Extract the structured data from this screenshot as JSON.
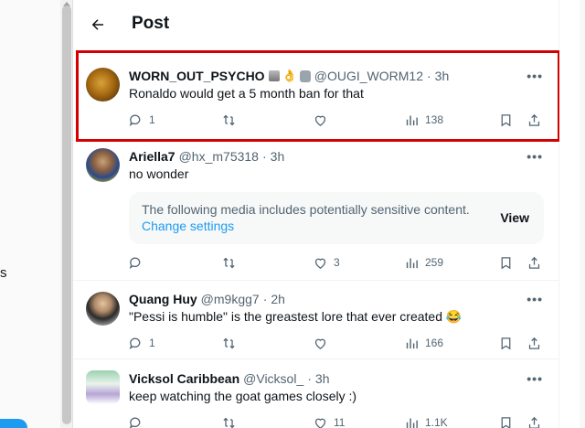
{
  "left_rail": {
    "edge_text": "s"
  },
  "header": {
    "title": "Post"
  },
  "posts": [
    {
      "name": "WORN_OUT_PSYCHO",
      "handle": "@OUGI_WORM12",
      "time": "3h",
      "text": "Ronaldo would get a 5 month ban for that",
      "replies": "1",
      "reposts": "",
      "likes": "",
      "views": "138"
    },
    {
      "name": "Ariella7",
      "handle": "@hx_m75318",
      "time": "3h",
      "text": "no wonder",
      "replies": "",
      "reposts": "",
      "likes": "3",
      "views": "259",
      "sensitive": {
        "notice": "The following media includes potentially sensitive content.",
        "link": "Change settings",
        "view": "View"
      }
    },
    {
      "name": "Quang Huy",
      "handle": "@m9kgg7",
      "time": "2h",
      "text": "\"Pessi is humble\" is the greastest lore that ever created 😂",
      "replies": "1",
      "reposts": "",
      "likes": "",
      "views": "166"
    },
    {
      "name": "Vicksol Caribbean",
      "handle": "@Vicksol_",
      "time": "3h",
      "text": "keep watching the goat games closely :)",
      "replies": "",
      "reposts": "",
      "likes": "11",
      "views": "1.1K"
    }
  ],
  "colors": {
    "accent": "#1d9bf0",
    "highlight_border": "#d40000",
    "muted": "#536471"
  },
  "icons": [
    "back-arrow-icon",
    "reply-icon",
    "repost-icon",
    "like-icon",
    "views-icon",
    "bookmark-icon",
    "share-icon",
    "more-icon"
  ]
}
